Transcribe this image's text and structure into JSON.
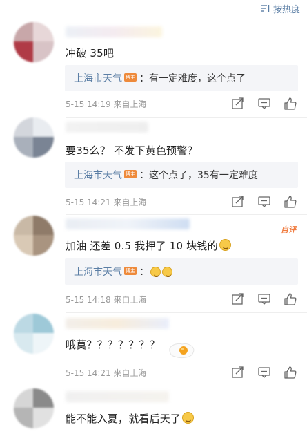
{
  "sort": {
    "label": "按热度"
  },
  "comments": [
    {
      "text": "冲破 35吧",
      "reply": {
        "name": "上海市天气",
        "badge": "博主",
        "text": "：有一定难度，这个点了"
      },
      "meta": "5-15 14:19  来自上海"
    },
    {
      "text": "要35么？ 不发下黄色预警？",
      "reply": {
        "name": "上海市天气",
        "badge": "博主",
        "text": "：这个点了，35有一定难度"
      },
      "meta": "5-15 14:21  来自上海"
    },
    {
      "text": "加油 还差 0.5 我押了 10 块钱的",
      "tag": "自评",
      "reply": {
        "name": "上海市天气",
        "badge": "博主",
        "text": "："
      },
      "meta": "5-15 14:18  来自上海"
    },
    {
      "text": "哦莫？？？？？？？",
      "meta": "5-15 14:21  来自上海"
    },
    {
      "text": "能不能入夏，就看后天了"
    }
  ],
  "icons": {
    "sort": "sort-icon",
    "share": "share-icon",
    "comment": "comment-icon",
    "like": "thumbs-up-icon",
    "emoji": "laughing-emoji-icon"
  },
  "colors": {
    "link": "#5b7ea5",
    "badge": "#ee8a3b",
    "meta": "#9a9a9a",
    "reply_bg": "#f4f5f8"
  }
}
